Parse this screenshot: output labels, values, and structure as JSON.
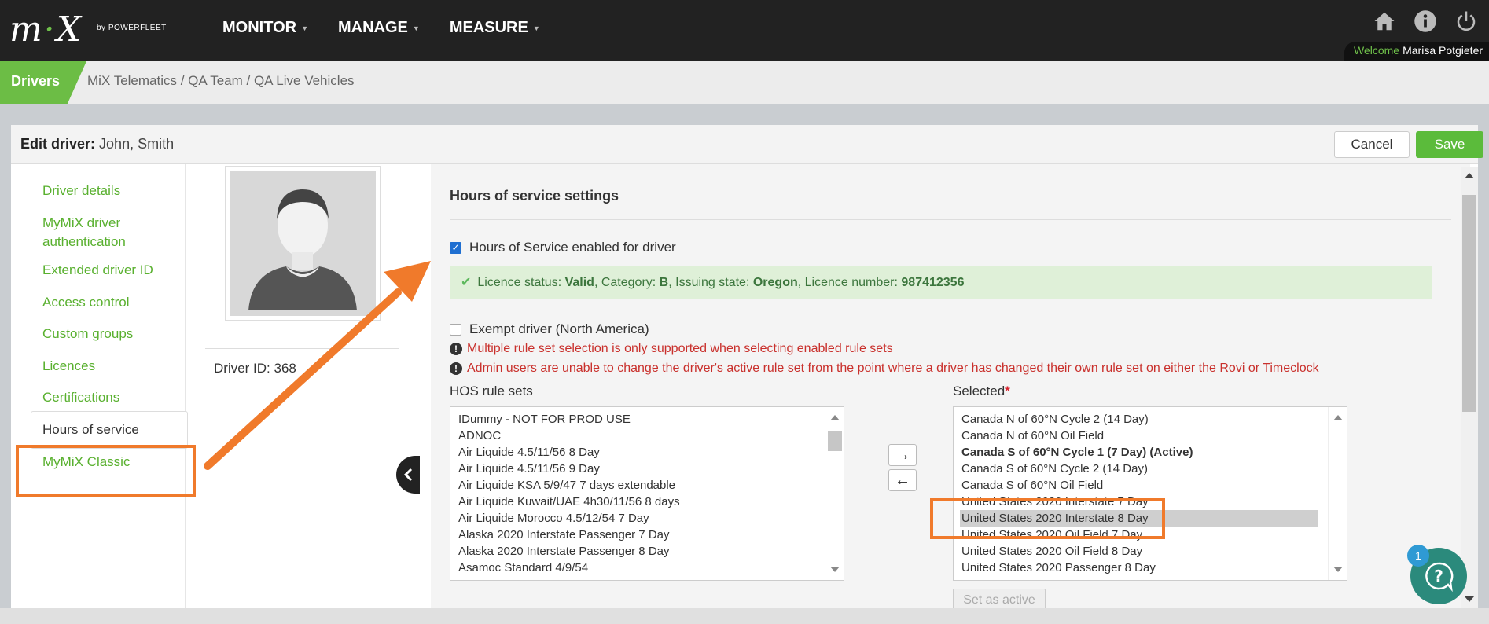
{
  "app": {
    "logo": "mix",
    "byline": "by POWERFLEET",
    "nav": [
      {
        "label": "MONITOR"
      },
      {
        "label": "MANAGE"
      },
      {
        "label": "MEASURE"
      }
    ],
    "icons": [
      "home-icon",
      "info-icon",
      "power-icon"
    ],
    "welcome_label": "Welcome",
    "user_name": "Marisa Potgieter"
  },
  "breadcrumb": {
    "section": "Drivers",
    "path": "MiX Telematics / QA Team / QA Live Vehicles"
  },
  "header": {
    "title_prefix": "Edit driver:",
    "title_name": "John, Smith",
    "cancel": "Cancel",
    "save": "Save"
  },
  "sidebar": {
    "items": [
      {
        "label": "Driver details"
      },
      {
        "label": "MyMiX driver authentication"
      },
      {
        "label": "Extended driver ID"
      },
      {
        "label": "Access control"
      },
      {
        "label": "Custom groups"
      },
      {
        "label": "Licences"
      },
      {
        "label": "Certifications"
      },
      {
        "label": "Hours of service",
        "active": true
      },
      {
        "label": "MyMiX Classic"
      }
    ]
  },
  "driver": {
    "id_label": "Driver ID: 368"
  },
  "hos": {
    "title": "Hours of service settings",
    "enabled_label": "Hours of Service enabled for driver",
    "enabled": true,
    "licence": {
      "status_label": "Licence status:",
      "status": "Valid",
      "category_label": "Category:",
      "category": "B",
      "state_label": "Issuing state:",
      "state": "Oregon",
      "number_label": "Licence number:",
      "number": "987412356"
    },
    "exempt_label": "Exempt driver (North America)",
    "exempt": false,
    "warnings": [
      "Multiple rule set selection is only supported when selecting enabled rule sets",
      "Admin users are unable to change the driver's active rule set from the point where a driver has changed their own rule set on either the Rovi or Timeclock"
    ],
    "rule_sets_label": "HOS rule sets",
    "selected_label": "Selected",
    "required_mark": "*",
    "rule_sets": [
      "IDummy - NOT FOR PROD USE",
      "ADNOC",
      "Air Liquide 4.5/11/56 8 Day",
      "Air Liquide 4.5/11/56 9 Day",
      "Air Liquide KSA 5/9/47 7 days extendable",
      "Air Liquide Kuwait/UAE 4h30/11/56 8 days",
      "Air Liquide Morocco 4.5/12/54 7 Day",
      "Alaska 2020 Interstate Passenger 7 Day",
      "Alaska 2020 Interstate Passenger 8 Day",
      "Asamoc Standard 4/9/54"
    ],
    "selected_sets": [
      "Canada N of 60°N Cycle 2 (14 Day)",
      "Canada N of 60°N Oil Field",
      "Canada S of 60°N Cycle 1 (7 Day) (Active)",
      "Canada S of 60°N Cycle 2 (14 Day)",
      "Canada S of 60°N Oil Field",
      "United States 2020 Interstate 7 Day",
      "United States 2020 Interstate 8 Day",
      "United States 2020 Oil Field 7 Day",
      "United States 2020 Oil Field 8 Day",
      "United States 2020 Passenger 8 Day"
    ],
    "selected_active_index": 2,
    "selected_highlight_index": 6,
    "move_right": "→",
    "move_left": "←",
    "set_active": "Set as active"
  },
  "help": {
    "badge": "1",
    "icon": "help-question-icon"
  },
  "colors": {
    "brand_green": "#6cbd45",
    "link_green": "#59b02f",
    "annotation_orange": "#f07a2b",
    "warning_red": "#c9302c",
    "success_bg": "#dff0d8"
  }
}
